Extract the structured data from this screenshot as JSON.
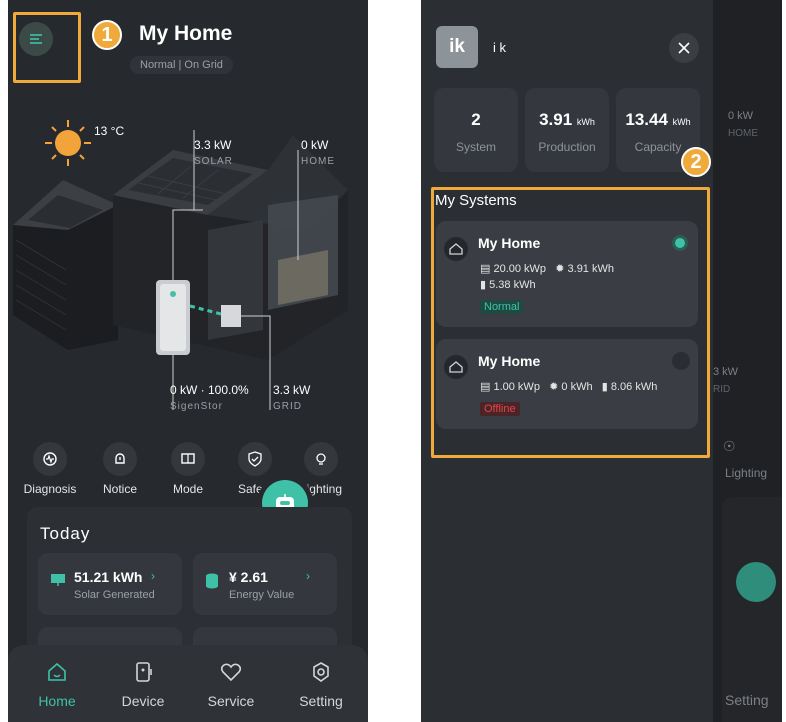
{
  "left": {
    "title": "My Home",
    "subtitle": "Normal | On Grid",
    "badge": "1",
    "weather": {
      "temp": "13 °C",
      "icon": "sun-icon"
    },
    "house_labels": {
      "solar_value": "3.3 kW",
      "solar_label": "SOLAR",
      "home_value": "0 kW",
      "home_label": "HOME",
      "storage_value": "0 kW · 100.0%",
      "storage_label": "SigenStor",
      "grid_value": "3.3 kW",
      "grid_label": "GRID"
    },
    "features": [
      {
        "label": "Diagnosis",
        "icon": "diagnosis-icon"
      },
      {
        "label": "Notice",
        "icon": "bell-icon"
      },
      {
        "label": "Mode",
        "icon": "mode-icon"
      },
      {
        "label": "Safety",
        "icon": "shield-icon"
      },
      {
        "label": "Lighting",
        "icon": "bulb-icon"
      }
    ],
    "today": {
      "title": "Today",
      "solar_value": "51.21 kWh",
      "solar_label": "Solar Generated",
      "energy_value": "¥ 2.61",
      "energy_label": "Energy Value"
    },
    "tabs": [
      {
        "label": "Home",
        "icon": "home-icon"
      },
      {
        "label": "Device",
        "icon": "device-icon"
      },
      {
        "label": "Service",
        "icon": "service-icon"
      },
      {
        "label": "Setting",
        "icon": "gear-icon"
      }
    ],
    "accent": "#3fc1a8"
  },
  "right": {
    "avatar": "ik",
    "username": "i k",
    "badge": "2",
    "stats": [
      {
        "value": "2",
        "unit": "",
        "label": "System"
      },
      {
        "value": "3.91",
        "unit": "kWh",
        "label": "Production"
      },
      {
        "value": "13.44",
        "unit": "kWh",
        "label": "Capacity"
      }
    ],
    "section_title": "My Systems",
    "systems": [
      {
        "name": "My Home",
        "capacity": "20.00 kWp",
        "production": "3.91 kWh",
        "storage": "5.38 kWh",
        "status": "Normal",
        "selected": true
      },
      {
        "name": "My Home",
        "capacity": "1.00 kWp",
        "production": "0 kWh",
        "storage": "8.06 kWh",
        "status": "Offline",
        "selected": false
      }
    ],
    "background": {
      "home_value": "0 kW",
      "home_label": "HOME",
      "grid_value": "3 kW",
      "grid_label": "RID",
      "lighting": "Lighting",
      "setting": "Setting"
    },
    "status_colors": {
      "normal": "#3fc1a8",
      "offline": "#e0464f"
    }
  }
}
